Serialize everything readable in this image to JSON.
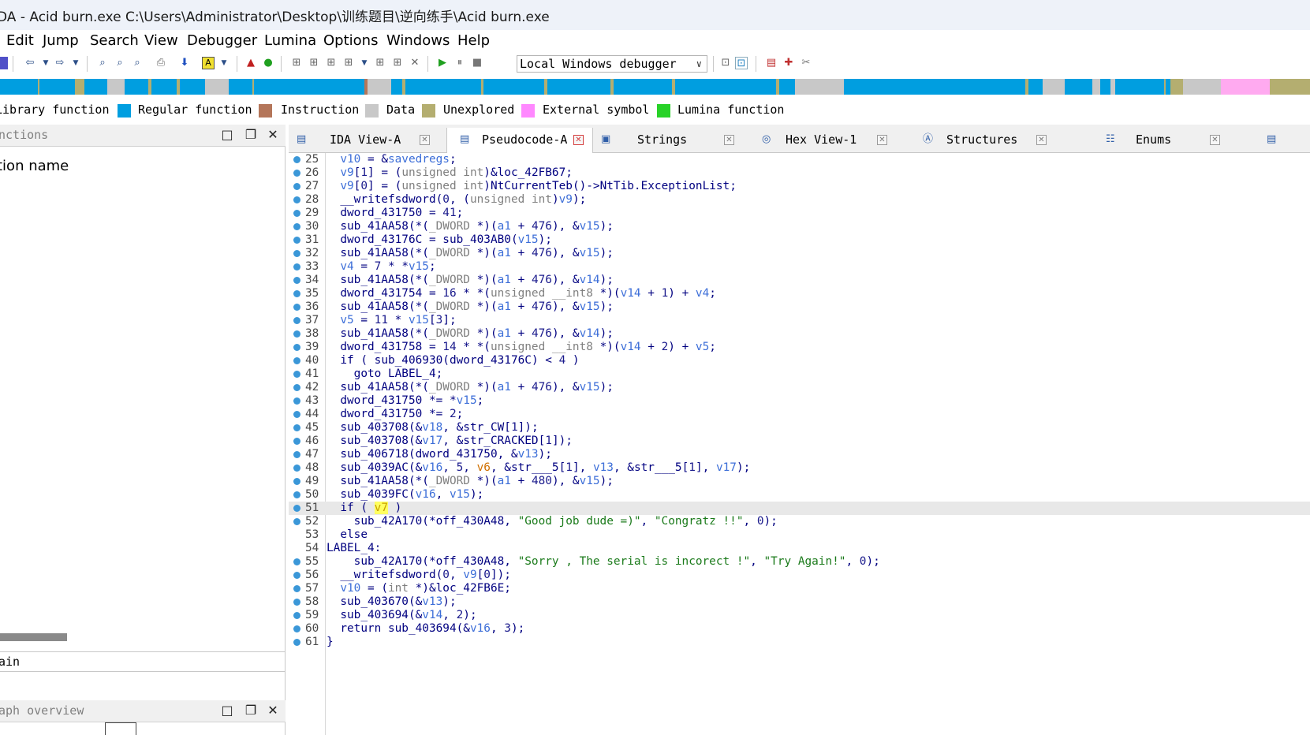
{
  "window": {
    "title": "DA - Acid burn.exe C:\\Users\\Administrator\\Desktop\\训练题目\\逆向练手\\Acid burn.exe"
  },
  "menu": [
    "Edit",
    "Jump",
    "Search",
    "View",
    "Debugger",
    "Lumina",
    "Options",
    "Windows",
    "Help"
  ],
  "toolbar": {
    "debugger_select": "Local Windows debugger"
  },
  "legend": [
    {
      "label": "Library function",
      "color": "#00d8ff"
    },
    {
      "label": "Regular function",
      "color": "#009ee0"
    },
    {
      "label": "Instruction",
      "color": "#b4765a"
    },
    {
      "label": "Data",
      "color": "#c8c8c8"
    },
    {
      "label": "Unexplored",
      "color": "#b4ae70"
    },
    {
      "label": "External symbol",
      "color": "#ff88ff"
    },
    {
      "label": "Lumina function",
      "color": "#28d228"
    }
  ],
  "left_panel": {
    "title": "nctions",
    "column_header": "tion name",
    "function_line": "ain",
    "graph_title": "aph overview"
  },
  "tabs": [
    {
      "label": "IDA View-A"
    },
    {
      "label": "Pseudocode-A"
    },
    {
      "label": "Strings"
    },
    {
      "label": "Hex View-1"
    },
    {
      "label": "Structures"
    },
    {
      "label": "Enums"
    }
  ],
  "code": {
    "highlight_line": "51",
    "lines": [
      {
        "n": "25",
        "dot": true,
        "text": "  v10 = &savedregs;"
      },
      {
        "n": "26",
        "dot": true,
        "text": "  v9[1] = (unsigned int)&loc_42FB67;"
      },
      {
        "n": "27",
        "dot": true,
        "text": "  v9[0] = (unsigned int)NtCurrentTeb()->NtTib.ExceptionList;"
      },
      {
        "n": "28",
        "dot": true,
        "text": "  __writefsdword(0, (unsigned int)v9);"
      },
      {
        "n": "29",
        "dot": true,
        "text": "  dword_431750 = 41;"
      },
      {
        "n": "30",
        "dot": true,
        "text": "  sub_41AA58(*(_DWORD *)(a1 + 476), &v15);"
      },
      {
        "n": "31",
        "dot": true,
        "text": "  dword_43176C = sub_403AB0(v15);"
      },
      {
        "n": "32",
        "dot": true,
        "text": "  sub_41AA58(*(_DWORD *)(a1 + 476), &v15);"
      },
      {
        "n": "33",
        "dot": true,
        "text": "  v4 = 7 * *v15;"
      },
      {
        "n": "34",
        "dot": true,
        "text": "  sub_41AA58(*(_DWORD *)(a1 + 476), &v14);"
      },
      {
        "n": "35",
        "dot": true,
        "text": "  dword_431754 = 16 * *(unsigned __int8 *)(v14 + 1) + v4;"
      },
      {
        "n": "36",
        "dot": true,
        "text": "  sub_41AA58(*(_DWORD *)(a1 + 476), &v15);"
      },
      {
        "n": "37",
        "dot": true,
        "text": "  v5 = 11 * v15[3];"
      },
      {
        "n": "38",
        "dot": true,
        "text": "  sub_41AA58(*(_DWORD *)(a1 + 476), &v14);"
      },
      {
        "n": "39",
        "dot": true,
        "text": "  dword_431758 = 14 * *(unsigned __int8 *)(v14 + 2) + v5;"
      },
      {
        "n": "40",
        "dot": true,
        "text": "  if ( sub_406930(dword_43176C) < 4 )"
      },
      {
        "n": "41",
        "dot": true,
        "text": "    goto LABEL_4;"
      },
      {
        "n": "42",
        "dot": true,
        "text": "  sub_41AA58(*(_DWORD *)(a1 + 476), &v15);"
      },
      {
        "n": "43",
        "dot": true,
        "text": "  dword_431750 *= *v15;"
      },
      {
        "n": "44",
        "dot": true,
        "text": "  dword_431750 *= 2;"
      },
      {
        "n": "45",
        "dot": true,
        "text": "  sub_403708(&v18, &str_CW[1]);"
      },
      {
        "n": "46",
        "dot": true,
        "text": "  sub_403708(&v17, &str_CRACKED[1]);"
      },
      {
        "n": "47",
        "dot": true,
        "text": "  sub_406718(dword_431750, &v13);"
      },
      {
        "n": "48",
        "dot": true,
        "text": "  sub_4039AC(&v16, 5, v6, &str___5[1], v13, &str___5[1], v17);"
      },
      {
        "n": "49",
        "dot": true,
        "text": "  sub_41AA58(*(_DWORD *)(a1 + 480), &v15);"
      },
      {
        "n": "50",
        "dot": true,
        "text": "  sub_4039FC(v16, v15);"
      },
      {
        "n": "51",
        "dot": true,
        "text": "  if ( v7 )"
      },
      {
        "n": "52",
        "dot": true,
        "text": "    sub_42A170(*off_430A48, \"Good job dude =)\", \"Congratz !!\", 0);"
      },
      {
        "n": "53",
        "dot": false,
        "text": "  else"
      },
      {
        "n": "54",
        "dot": false,
        "text": "LABEL_4:"
      },
      {
        "n": "55",
        "dot": true,
        "text": "    sub_42A170(*off_430A48, \"Sorry , The serial is incorect !\", \"Try Again!\", 0);"
      },
      {
        "n": "56",
        "dot": true,
        "text": "  __writefsdword(0, v9[0]);"
      },
      {
        "n": "57",
        "dot": true,
        "text": "  v10 = (int *)&loc_42FB6E;"
      },
      {
        "n": "58",
        "dot": true,
        "text": "  sub_403670(&v13);"
      },
      {
        "n": "59",
        "dot": true,
        "text": "  sub_403694(&v14, 2);"
      },
      {
        "n": "60",
        "dot": true,
        "text": "  return sub_403694(&v16, 3);"
      },
      {
        "n": "61",
        "dot": true,
        "text": "}"
      }
    ]
  }
}
